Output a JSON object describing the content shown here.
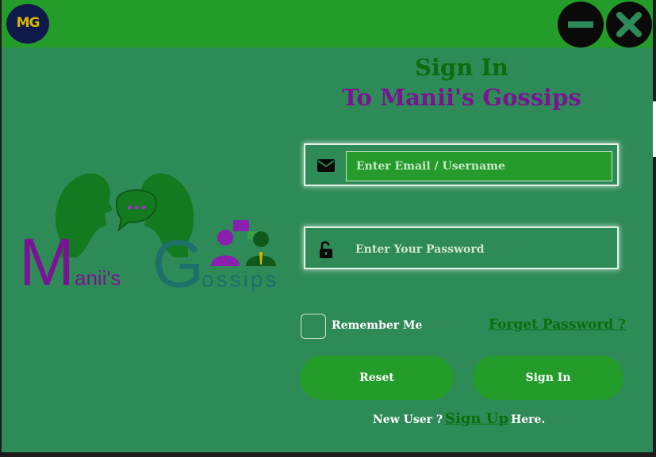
{
  "window": {
    "logo_text": "MG",
    "minimize_icon": "minus-icon",
    "close_icon": "x-icon"
  },
  "brand": {
    "word1": "M",
    "word1_rest": "anii's",
    "word2": "G",
    "word2_rest": "ossips",
    "colors": {
      "purple": "#7a1494",
      "teal": "#1f6f6a",
      "green": "#0e6b0e"
    }
  },
  "heading": {
    "line1": "Sign In",
    "line2": "To Manii's Gossips"
  },
  "form": {
    "email_placeholder": "Enter Email / Username",
    "email_icon": "envelope-icon",
    "password_placeholder": "Enter Your Password",
    "password_icon": "unlock-icon",
    "remember_label": "Remember Me",
    "forget_label": "Forget Password ?",
    "reset_label": "Reset",
    "signin_label": "Sign In",
    "new_user_label": "New User ?",
    "signup_label": "Sign Up",
    "here_label": "Here."
  },
  "colors": {
    "background": "#2e8b57",
    "titlebar": "#249c2a",
    "button": "#249c2a",
    "link": "#0b6d0b"
  }
}
